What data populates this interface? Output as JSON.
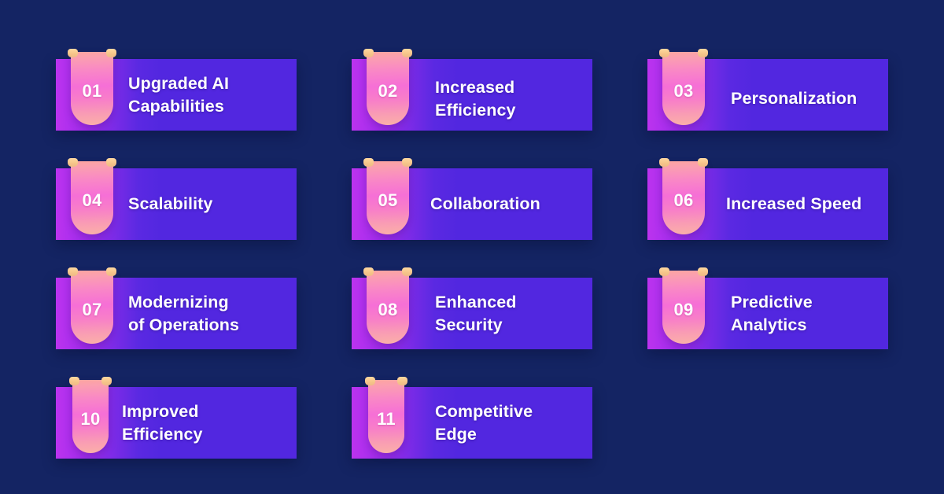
{
  "page": {
    "background_color": "#142463",
    "card_gradient_from": "#bc33ef",
    "card_gradient_to": "#5227e0",
    "badge_gradient_from": "#fca5a0",
    "badge_gradient_to": "#f66fd6",
    "tab_color": "#ffd9a0",
    "text_color": "#ffffff",
    "columns": 3,
    "rows": 4,
    "item_count": 11
  },
  "items": [
    {
      "number": "01",
      "label": "Upgraded AI\nCapabilities"
    },
    {
      "number": "02",
      "label": "Increased\nEfficiency"
    },
    {
      "number": "03",
      "label": "Personalization"
    },
    {
      "number": "04",
      "label": "Scalability"
    },
    {
      "number": "05",
      "label": "Collaboration"
    },
    {
      "number": "06",
      "label": "Increased Speed"
    },
    {
      "number": "07",
      "label": "Modernizing\nof Operations"
    },
    {
      "number": "08",
      "label": "Enhanced\nSecurity"
    },
    {
      "number": "09",
      "label": "Predictive\nAnalytics"
    },
    {
      "number": "10",
      "label": "Improved\nEfficiency"
    },
    {
      "number": "11",
      "label": "Competitive\nEdge"
    }
  ]
}
